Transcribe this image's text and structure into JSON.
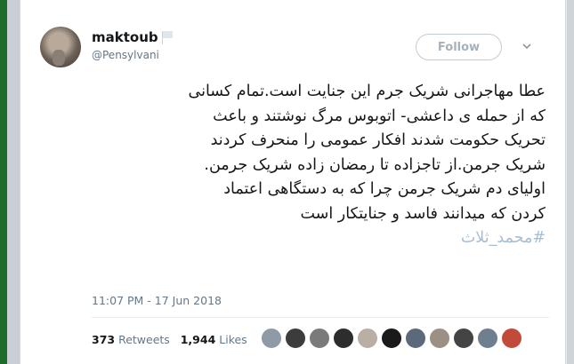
{
  "tweet": {
    "display_name": "maktoub",
    "handle": "@Pensylvani",
    "follow_label": "Follow",
    "text_lines": [
      "عطا مهاجرانی شریک جرم این جنایت است.تمام کسانی",
      "که از حمله ی داعشی- اتوبوس مرگ نوشتند و باعث",
      "تحریک حکومت شدند افکار عمومی را منحرف کردند",
      "شریک جرمن.از تاجزاده تا رمضان زاده شریک جرمن.",
      "اولیای دم شریک جرمن چرا که به دستگاهی اعتماد",
      "کردن که میدانند فاسد و جنایتکار است"
    ],
    "hashtag": "#محمد_ثلاث",
    "timestamp": "11:07 PM - 17 Jun 2018",
    "retweets_count": "373",
    "retweets_label": "Retweets",
    "likes_count": "1,944",
    "likes_label": "Likes"
  },
  "icons": {
    "flag": "flag-icon",
    "chevron": "chevron-down-icon"
  },
  "liker_avatar_colors": [
    "#8e9aa6",
    "#3c3c3c",
    "#7a7a7a",
    "#2d2d2d",
    "#b9b0a3",
    "#1a1a1a",
    "#5a6a7a",
    "#9c8f83",
    "#444444",
    "#6e7f90",
    "#c24a3a"
  ],
  "colors": {
    "text": "#14171a",
    "secondary": "#657786",
    "hashtag": "#a7bdd0",
    "follow_border": "#c3cbd2"
  }
}
